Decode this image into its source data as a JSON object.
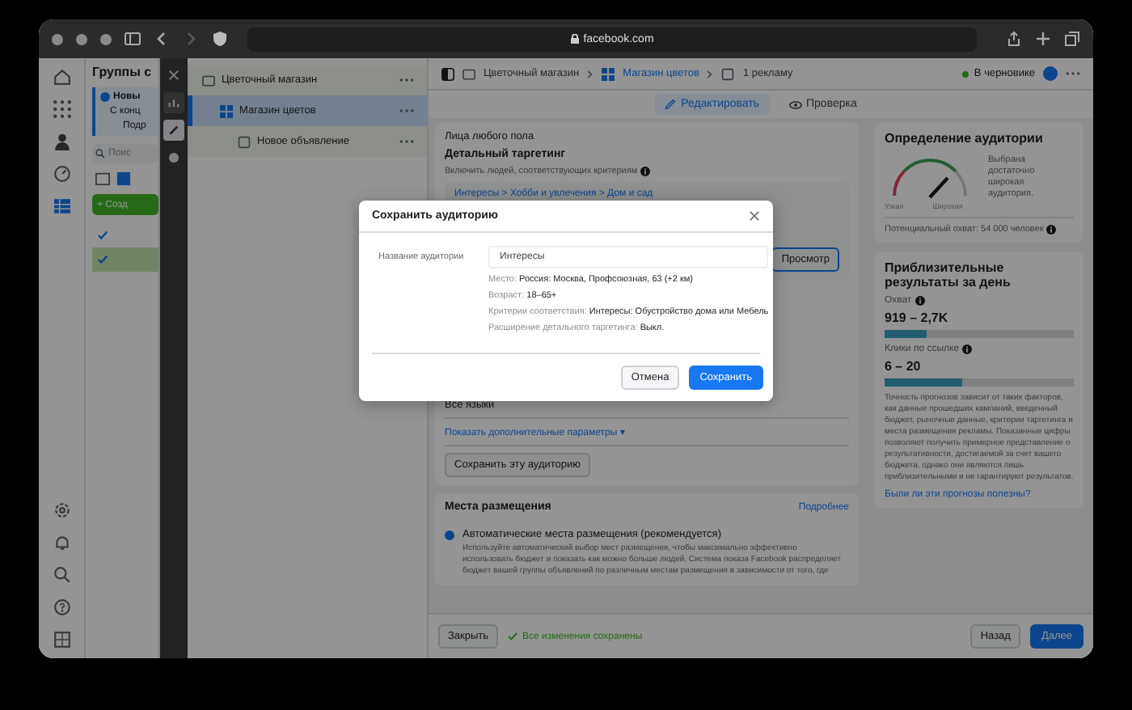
{
  "browser": {
    "url": "facebook.com"
  },
  "groups_panel": {
    "title": "Группы с",
    "notice": {
      "title": "Новы",
      "text": "С конц",
      "button": "Подр"
    },
    "search": {
      "placeholder": "Поис"
    },
    "create_button": "+ Созд",
    "rows": [
      {
        "checked": true,
        "selected": false
      },
      {
        "checked": true,
        "selected": true
      }
    ]
  },
  "tree": [
    {
      "label": "Цветочный магазин",
      "selected": false,
      "children": [
        {
          "label": "Магазин цветов",
          "selected": true,
          "children": [
            {
              "label": "Новое объявление",
              "selected": false
            }
          ]
        }
      ]
    }
  ],
  "header": {
    "breadcrumb": [
      "Цветочный магазин",
      "Магазин цветов",
      "1 рекламу"
    ],
    "status": "В черновике",
    "tabs": [
      {
        "label": "Редактировать",
        "selected": true
      },
      {
        "label": "Проверка",
        "selected": false
      }
    ]
  },
  "audience": {
    "gender": "Лица любого пола",
    "detailed_title": "Детальный таргетинг",
    "detailed_subtitle": "Включить людей, соответствующих критериям",
    "interest_path": "Интересы > Хобби и увлечения > Дом и сад",
    "preview_button": "Просмотр",
    "languages": "Все языки",
    "more_link": "Показать дополнительные параметры ▾",
    "save_button": "Сохранить эту аудиторию"
  },
  "placements": {
    "title": "Места размещения",
    "link": "Подробнее",
    "options": [
      {
        "label": "Автоматические места размещения (рекомендуется)",
        "description": "Используйте автоматический выбор мест размещения, чтобы максимально эффективно использовать бюджет и показать как можно больше людей. Система показа Facebook распределяет бюджет вашей группы объявлений по различным местам размещения в зависимости от того, где",
        "selected": true
      }
    ]
  },
  "footer": {
    "close": "Закрыть",
    "saved": "Все изменения сохранены",
    "back": "Назад",
    "next": "Далее"
  },
  "definition": {
    "title": "Определение аудитории",
    "gauge_labels": [
      "Узкая",
      "Широкая"
    ],
    "verdict": "Выбрана достаточно широкая аудитория.",
    "potential_reach": "Потенциальный охват: 54 000 человек"
  },
  "estimates": {
    "title": "Приблизительные результаты за день",
    "metrics": [
      {
        "label": "Охват",
        "value": "919 – 2,7K",
        "level": 0.22
      },
      {
        "label": "Клики по ссылке",
        "value": "6 – 20",
        "level": 0.41
      }
    ],
    "disclaimer": "Точность прогнозов зависит от таких факторов, как данные прошедших кампаний, введенный бюджет, рыночные данные, критерии таргетинга и места размещения рекламы. Показанные цифры позволяют получить примерное представление о результативности, достигаемой за счет вашего бюджета, однако они являются лишь приблизительными и не гарантируют результатов.",
    "feedback_link": "Были ли эти прогнозы полезны?"
  },
  "dialog": {
    "title": "Сохранить аудиторию",
    "name_label": "Название аудитории",
    "name_value": "Интересы",
    "details": [
      {
        "label": "Место:",
        "value": "Россия: Москва, Профсоюзная, 63 (+2 км)"
      },
      {
        "label": "Возраст:",
        "value": "18–65+"
      },
      {
        "label": "Критерии соответствия:",
        "value": "Интересы: Обустройство дома или Мебель"
      },
      {
        "label": "Расширение детального таргетинга:",
        "value": "Выкл."
      }
    ],
    "cancel": "Отмена",
    "save": "Сохранить"
  }
}
